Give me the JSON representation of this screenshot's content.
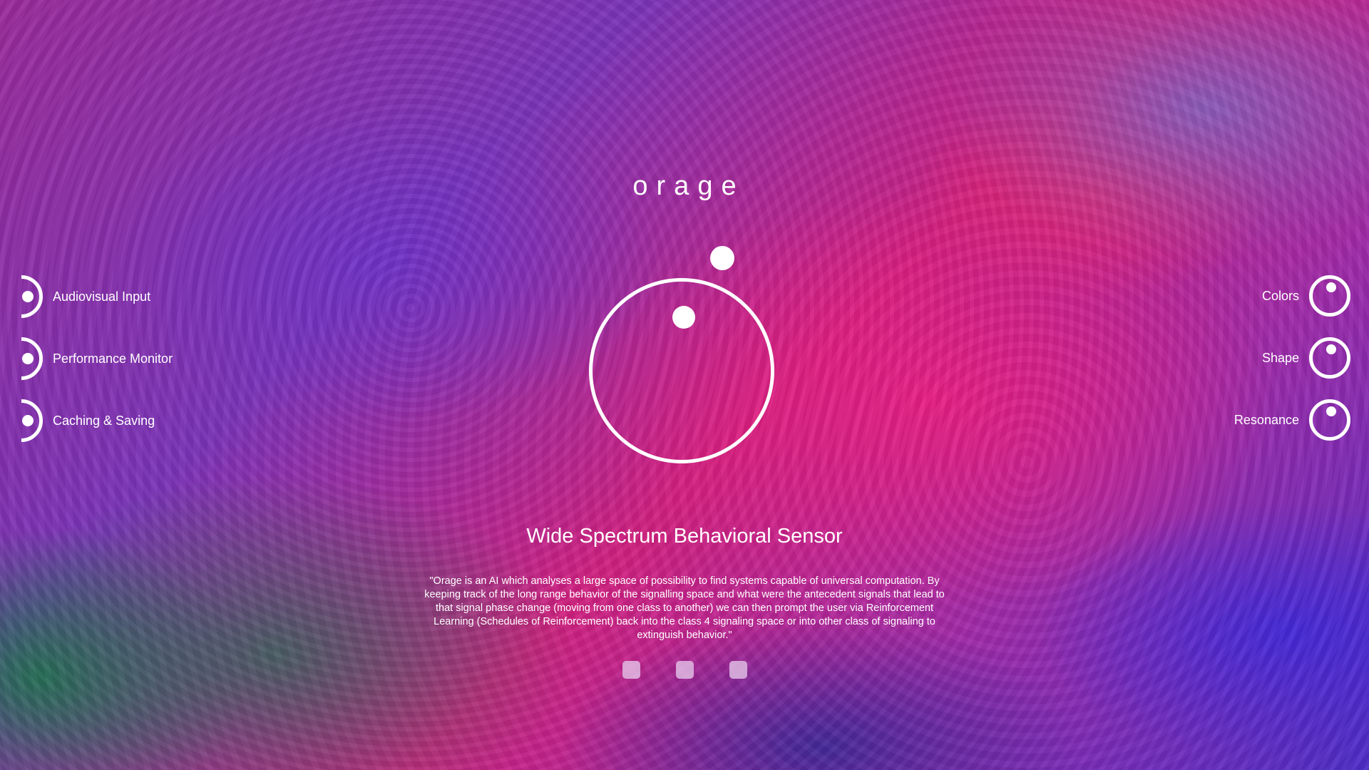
{
  "app": {
    "logo": "orage"
  },
  "menu_left": [
    {
      "label": "Audiovisual Input",
      "icon": "half-ring-icon"
    },
    {
      "label": "Performance Monitor",
      "icon": "half-ring-icon"
    },
    {
      "label": "Caching & Saving",
      "icon": "half-ring-icon"
    }
  ],
  "menu_right": [
    {
      "label": "Colors",
      "icon": "ring-icon"
    },
    {
      "label": "Shape",
      "icon": "ring-icon"
    },
    {
      "label": "Resonance",
      "icon": "ring-icon"
    }
  ],
  "main": {
    "headline": "Wide Spectrum Behavioral Sensor",
    "description": "\"Orage is an AI which analyses a large space of possibility to find systems capable of universal computation. By keeping track of the long range behavior of the signalling space and what were the antecedent signals that lead to that signal phase change (moving from one class to another) we can then prompt the user via Reinforcement Learning (Schedules of Reinforcement) back into the class 4 signaling space or into other class of signaling to extinguish behavior.\""
  },
  "pager": {
    "count": 3
  },
  "colors": {
    "accent": "#ffffff",
    "magenta": "#e01e82",
    "violet": "#7a34b8",
    "blue": "#4c2cc8"
  }
}
